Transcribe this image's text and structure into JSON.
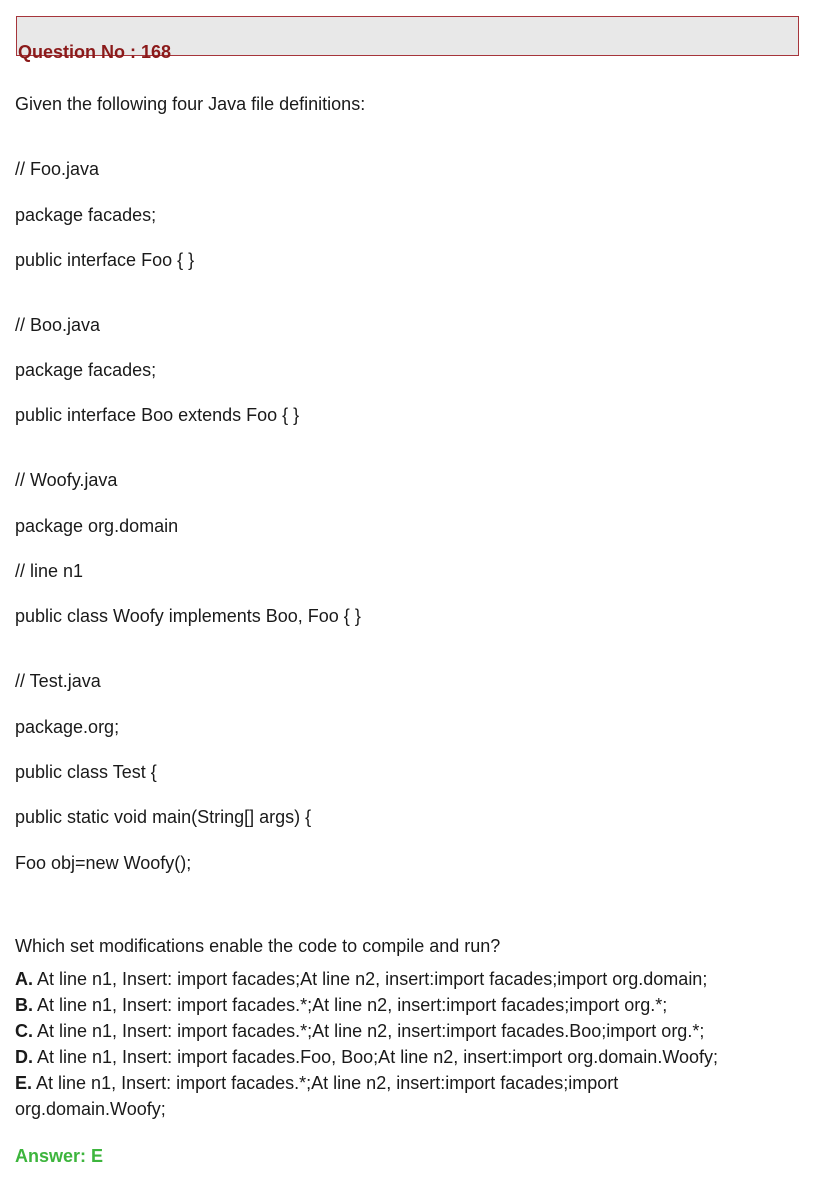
{
  "question": {
    "title": "Question No : 168",
    "intro": "Given the following four Java file definitions:",
    "code_lines": [
      "// Foo.java",
      "package facades;",
      "public interface Foo { }",
      "// Boo.java",
      "package facades;",
      "public interface Boo extends Foo { }",
      "// Woofy.java",
      "package org.domain",
      "// line n1",
      "public class Woofy implements Boo, Foo { }",
      "// Test.java",
      "package.org;",
      "public class Test {",
      "public static void main(String[] args) {",
      "Foo obj=new Woofy();"
    ],
    "prompt": "Which set modifications enable the code to compile and run?",
    "options": [
      {
        "letter": "A.",
        "text": " At line n1, Insert: import facades;At line n2, insert:import facades;import org.domain;"
      },
      {
        "letter": "B.",
        "text": " At line n1, Insert: import facades.*;At line n2, insert:import facades;import org.*;"
      },
      {
        "letter": "C.",
        "text": " At line n1, Insert: import facades.*;At line n2, insert:import facades.Boo;import org.*;"
      },
      {
        "letter": "D.",
        "text": " At line n1, Insert: import facades.Foo, Boo;At line n2, insert:import org.domain.Woofy;"
      },
      {
        "letter": "E.",
        "text": " At line n1, Insert: import facades.*;At line n2, insert:import facades;import"
      }
    ],
    "option_e_continuation": "org.domain.Woofy;",
    "answer": "Answer: E"
  }
}
